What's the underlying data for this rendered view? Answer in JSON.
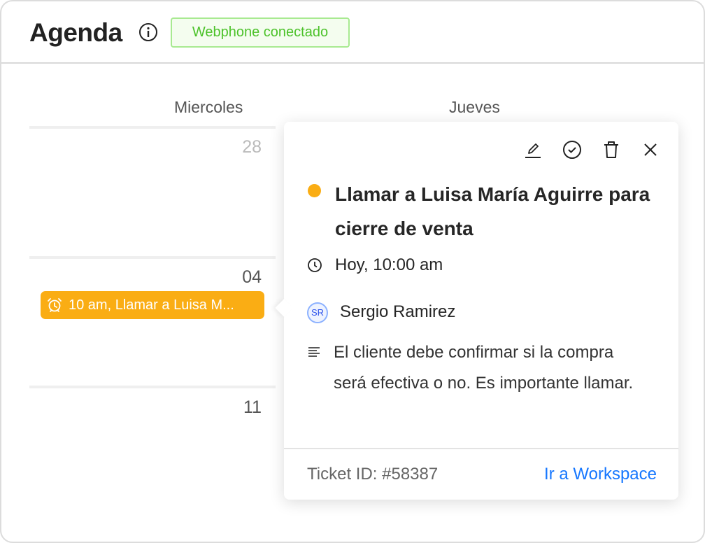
{
  "header": {
    "title": "Agenda",
    "status_badge": "Webphone conectado"
  },
  "calendar": {
    "columns": [
      "Miercoles",
      "Jueves"
    ],
    "days": [
      "28",
      "04",
      "11"
    ],
    "event_chip": "10 am, Llamar a Luisa M..."
  },
  "popover": {
    "title": "Llamar a Luisa María Aguirre para cierre de venta",
    "status_color": "#faad14",
    "time": "Hoy, 10:00 am",
    "assignee_initials": "SR",
    "assignee": "Sergio Ramirez",
    "description": "El cliente debe confirmar si la compra será efectiva o no. Es importante llamar.",
    "ticket": "Ticket ID: #58387",
    "link": "Ir a Workspace"
  }
}
